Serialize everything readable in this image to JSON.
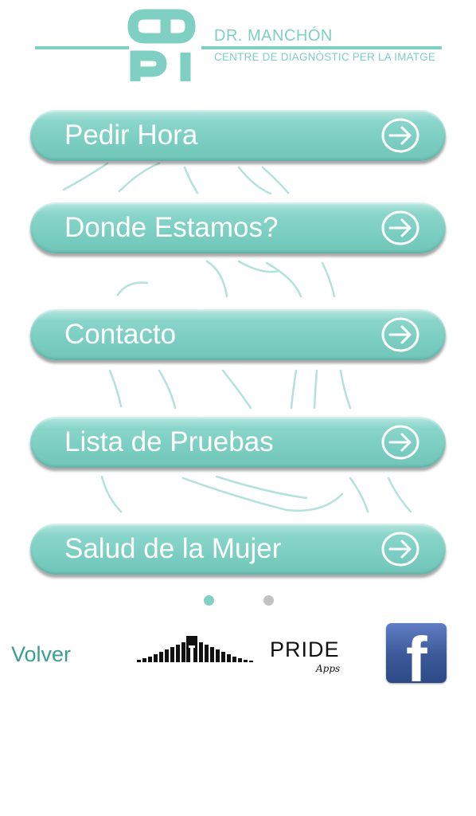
{
  "header": {
    "logo_letters": "CDPI",
    "brand_name": "DR. MANCHÓN",
    "brand_subtitle": "CENTRE DE DIAGNÒSTIC PER LA IMATGE"
  },
  "menu": {
    "items": [
      {
        "label": "Pedir Hora",
        "icon": "arrow-right-circle-icon"
      },
      {
        "label": "Donde Estamos?",
        "icon": "arrow-right-circle-icon"
      },
      {
        "label": "Contacto",
        "icon": "arrow-right-circle-icon"
      },
      {
        "label": "Lista de Pruebas",
        "icon": "arrow-right-circle-icon"
      },
      {
        "label": "Salud de la Mujer",
        "icon": "arrow-right-circle-icon"
      }
    ]
  },
  "pagination": {
    "pages": 2,
    "current": 1
  },
  "footer": {
    "back_label": "Volver",
    "developer_brand": "PRIDE",
    "developer_tagline": "Apps",
    "social_icon": "facebook-icon",
    "social_letter": "f"
  },
  "colors": {
    "accent": "#7fcfc3",
    "button_text": "#ffffff",
    "back_link": "#3c9e93",
    "facebook": "#3b5998"
  }
}
